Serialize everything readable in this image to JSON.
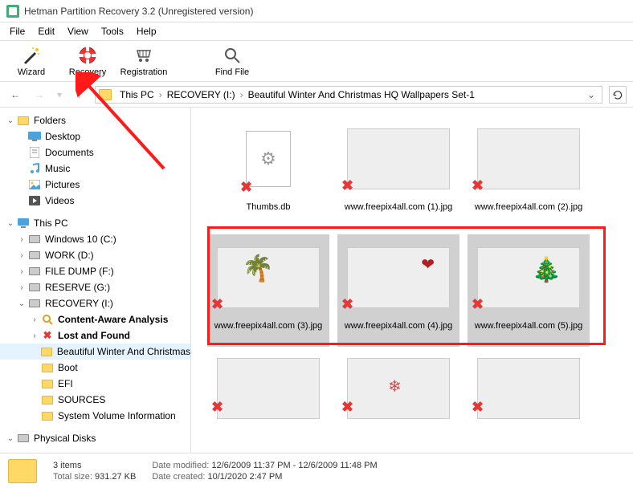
{
  "title": "Hetman Partition Recovery 3.2 (Unregistered version)",
  "menu": [
    "File",
    "Edit",
    "View",
    "Tools",
    "Help"
  ],
  "toolbar": [
    {
      "id": "wizard",
      "label": "Wizard"
    },
    {
      "id": "recovery",
      "label": "Recovery"
    },
    {
      "id": "registration",
      "label": "Registration"
    },
    {
      "id": "findfile",
      "label": "Find File"
    }
  ],
  "breadcrumb": {
    "parts": [
      "This PC",
      "RECOVERY (I:)",
      "Beautiful Winter And Christmas HQ Wallpapers Set-1"
    ]
  },
  "tree": {
    "folders_label": "Folders",
    "quick": [
      "Desktop",
      "Documents",
      "Music",
      "Pictures",
      "Videos"
    ],
    "thispc_label": "This PC",
    "drives": [
      "Windows 10 (C:)",
      "WORK (D:)",
      "FILE DUMP (F:)",
      "RESERVE (G:)"
    ],
    "recovery_label": "RECOVERY (I:)",
    "recovery_children": [
      {
        "label": "Content-Aware Analysis",
        "bold": true,
        "icon": "search"
      },
      {
        "label": "Lost and Found",
        "bold": true,
        "icon": "x"
      },
      {
        "label": "Beautiful Winter And Christmas",
        "bold": false,
        "icon": "folder",
        "selected": true
      },
      {
        "label": "Boot",
        "bold": false,
        "icon": "folder"
      },
      {
        "label": "EFI",
        "bold": false,
        "icon": "folder"
      },
      {
        "label": "SOURCES",
        "bold": false,
        "icon": "folder"
      },
      {
        "label": "System Volume Information",
        "bold": false,
        "icon": "folder"
      }
    ],
    "physical_label": "Physical Disks"
  },
  "files": [
    {
      "name": "Thumbs.db",
      "type": "doc"
    },
    {
      "name": "www.freepix4all.com (1).jpg",
      "type": "img",
      "bg": "bg1"
    },
    {
      "name": "www.freepix4all.com (2).jpg",
      "type": "img",
      "bg": "bg2"
    },
    {
      "name": "www.freepix4all.com (3).jpg",
      "type": "img",
      "bg": "bg3",
      "selected": true
    },
    {
      "name": "www.freepix4all.com (4).jpg",
      "type": "img",
      "bg": "bg4",
      "selected": true
    },
    {
      "name": "www.freepix4all.com (5).jpg",
      "type": "img",
      "bg": "bg5",
      "selected": true
    },
    {
      "name": "",
      "type": "img",
      "bg": "bg6",
      "partial": true
    },
    {
      "name": "",
      "type": "img",
      "bg": "bg7",
      "partial": true
    },
    {
      "name": "",
      "type": "img",
      "bg": "bg8",
      "partial": true
    }
  ],
  "status": {
    "items_count": "3 items",
    "total_size_label": "Total size:",
    "total_size": "931.27 KB",
    "date_modified_label": "Date modified:",
    "date_modified": "12/6/2009 11:37 PM - 12/6/2009 11:48 PM",
    "date_created_label": "Date created:",
    "date_created": "10/1/2020 2:47 PM"
  }
}
